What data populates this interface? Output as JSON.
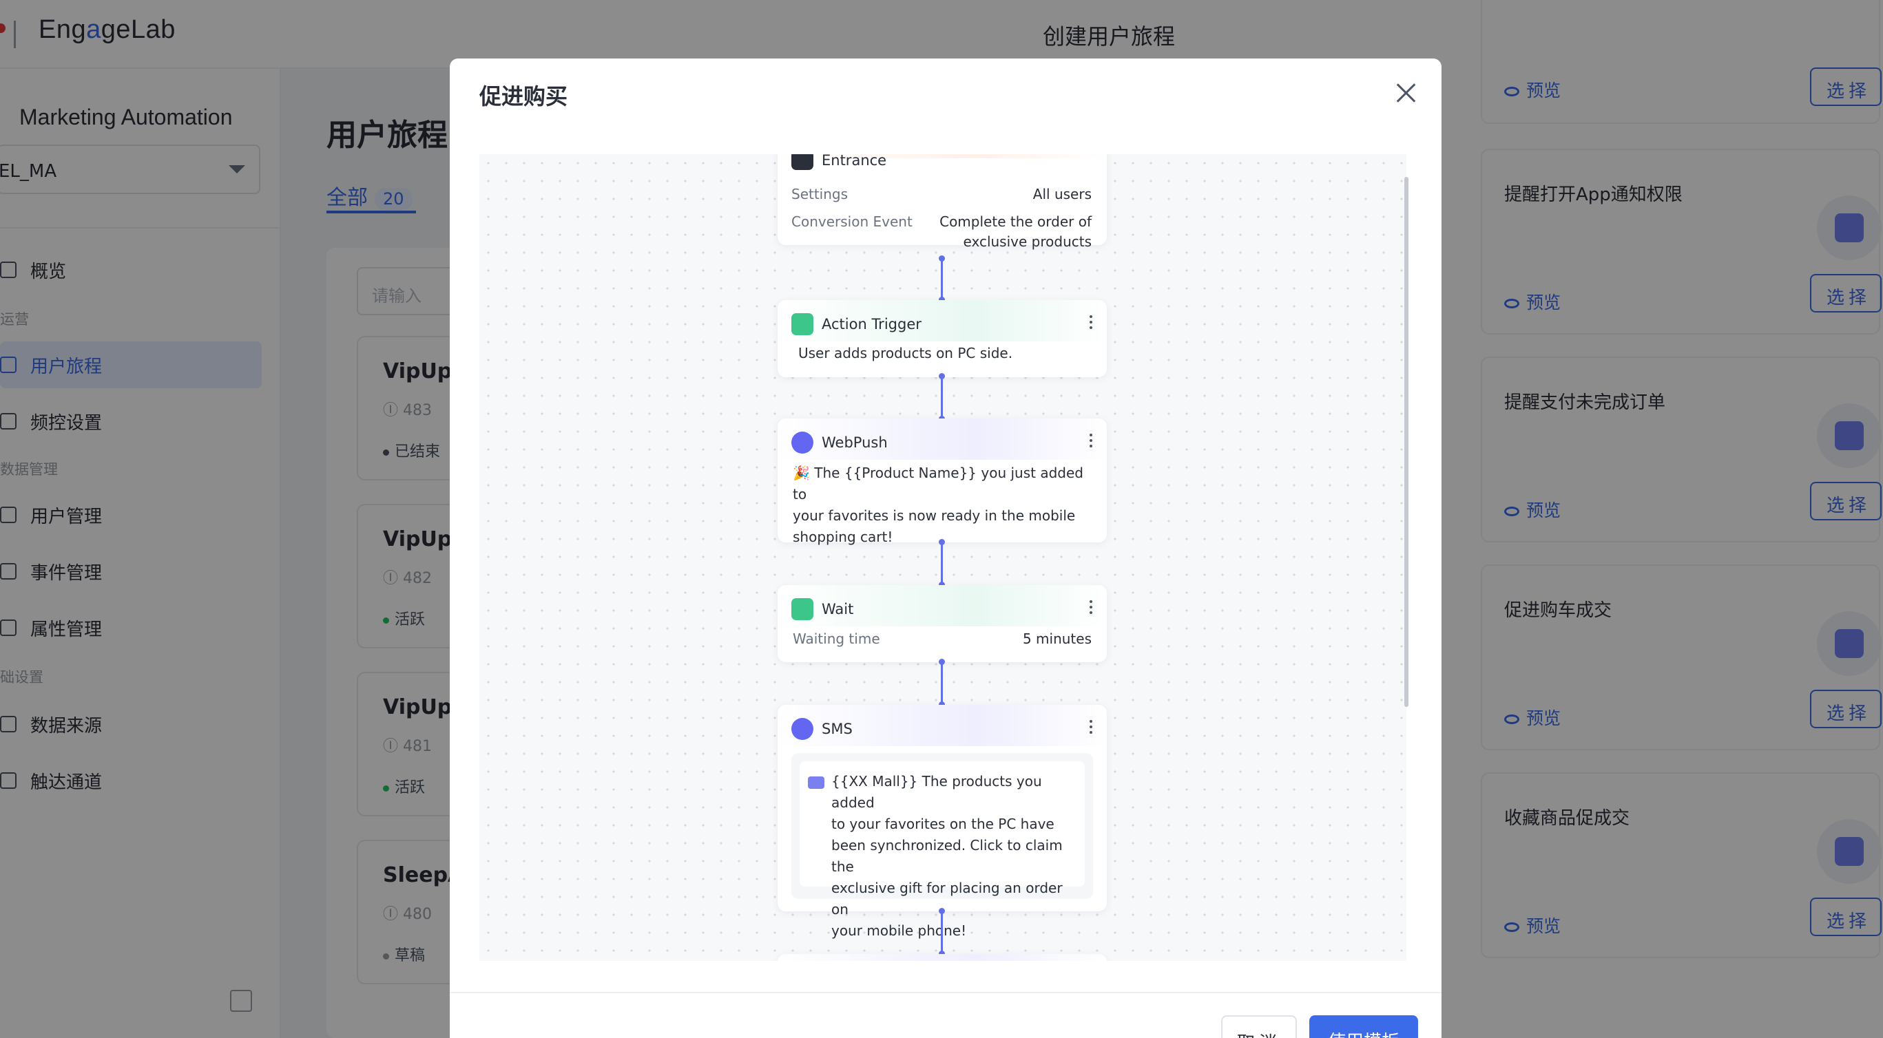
{
  "topbar": {
    "logo_text_1": "Eng",
    "logo_text_2": "a",
    "logo_text_3": "geLab"
  },
  "sidebar": {
    "app_title": "Marketing Automation",
    "app_selected": "EL_MA",
    "items": [
      {
        "label": "概览"
      },
      {
        "group": "运营"
      },
      {
        "label": "用户旅程"
      },
      {
        "label": "频控设置"
      },
      {
        "group": "数据管理"
      },
      {
        "label": "用户管理"
      },
      {
        "label": "事件管理"
      },
      {
        "label": "属性管理"
      },
      {
        "group": "础设置"
      },
      {
        "label": "数据来源"
      },
      {
        "label": "触达通道"
      }
    ]
  },
  "main": {
    "title": "用户旅程",
    "tab_all": "全部",
    "tab_all_count": "20",
    "search_placeholder": "请输入",
    "journeys": [
      {
        "name": "VipUpg",
        "id": "483",
        "status": "已结束",
        "status_color": "#4b5563"
      },
      {
        "name": "VipUpg",
        "id": "482",
        "status": "活跃",
        "status_color": "#22c55e"
      },
      {
        "name": "VipUpg",
        "id": "481",
        "status": "活跃",
        "status_color": "#22c55e"
      },
      {
        "name": "SleepA",
        "id": "480",
        "status": "草稿",
        "status_color": "#9aa0aa"
      }
    ]
  },
  "drawer": {
    "title": "创建用户旅程",
    "preview_label": "预览",
    "select_label": "选择",
    "templates": [
      {
        "name": "提醒打开App通知权限",
        "icon": "bell-icon"
      },
      {
        "name": "提醒支付未完成订单",
        "icon": "receipt-icon"
      },
      {
        "name": "促进购车成交",
        "icon": "cart-icon"
      },
      {
        "name": "收藏商品促成交",
        "icon": "basket-star-icon"
      }
    ]
  },
  "modal": {
    "title": "促进购买",
    "cancel_label": "取消",
    "use_label": "使用模板",
    "nodes": {
      "entrance": {
        "title": "Entrance",
        "settings_label": "Settings",
        "settings_value": "All users",
        "conversion_label": "Conversion Event",
        "conversion_value_1": "Complete the order of",
        "conversion_value_2": "exclusive products"
      },
      "action_trigger": {
        "title": "Action Trigger",
        "text": "User adds products on PC side."
      },
      "webpush": {
        "title": "WebPush",
        "line_1": "🎉 The {{Product Name}} you just added to",
        "line_2": "your favorites is now ready in the mobile",
        "line_3": "shopping cart!"
      },
      "wait": {
        "title": "Wait",
        "label": "Waiting time",
        "value": "5 minutes"
      },
      "sms": {
        "title": "SMS",
        "line_1": "{{XX Mall}} The products you added",
        "line_2": "to your favorites on the PC have",
        "line_3": "been synchronized. Click to claim the",
        "line_4": "exclusive gift for placing an order on",
        "line_5": "your mobile phone!"
      }
    }
  },
  "colors": {
    "accent": "#3b6be8",
    "connector": "#6270e8",
    "trigger_green": "#3cc68a",
    "webpush_purple": "#6366f1",
    "entrance_dark": "#2b2f3a"
  }
}
